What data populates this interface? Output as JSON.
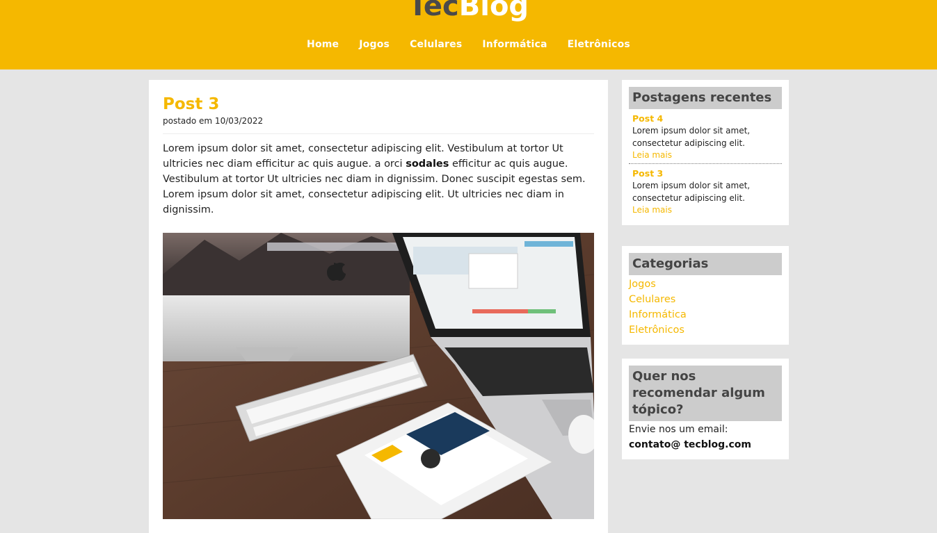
{
  "header": {
    "logo_part1": "Tec",
    "logo_part2": "Blog",
    "brand_color": "#f5b800",
    "nav": [
      "Home",
      "Jogos",
      "Celulares",
      "Informática",
      "Eletrônicos"
    ]
  },
  "post": {
    "title": "Post 3",
    "meta": "postado em 10/03/2022",
    "body_before": "Lorem ipsum dolor sit amet, consectetur adipiscing elit. Vestibulum at tortor Ut ultricies nec diam efficitur ac quis augue. a orci ",
    "body_bold": "sodales",
    "body_after": " efficitur ac quis augue. Vestibulum at tortor Ut ultricies nec diam in dignissim. Donec suscipit egestas sem. Lorem ipsum dolor sit amet, consectetur adipiscing elit. Ut ultricies nec diam in dignissim."
  },
  "sidebar": {
    "recent": {
      "title": "Postagens recentes",
      "items": [
        {
          "title": "Post 4",
          "text": "Lorem ipsum dolor sit amet, consectetur adipiscing elit.",
          "more": "Leia mais"
        },
        {
          "title": "Post 3",
          "text": "Lorem ipsum dolor sit amet, consectetur adipiscing elit.",
          "more": "Leia mais"
        }
      ]
    },
    "categories": {
      "title": "Categorias",
      "items": [
        "Jogos",
        "Celulares",
        "Informática",
        "Eletrônicos"
      ]
    },
    "recommend": {
      "title": "Quer nos recomendar algum tópico?",
      "text": "Envie nos um email:",
      "email": "contato@ tecblog.com"
    }
  }
}
